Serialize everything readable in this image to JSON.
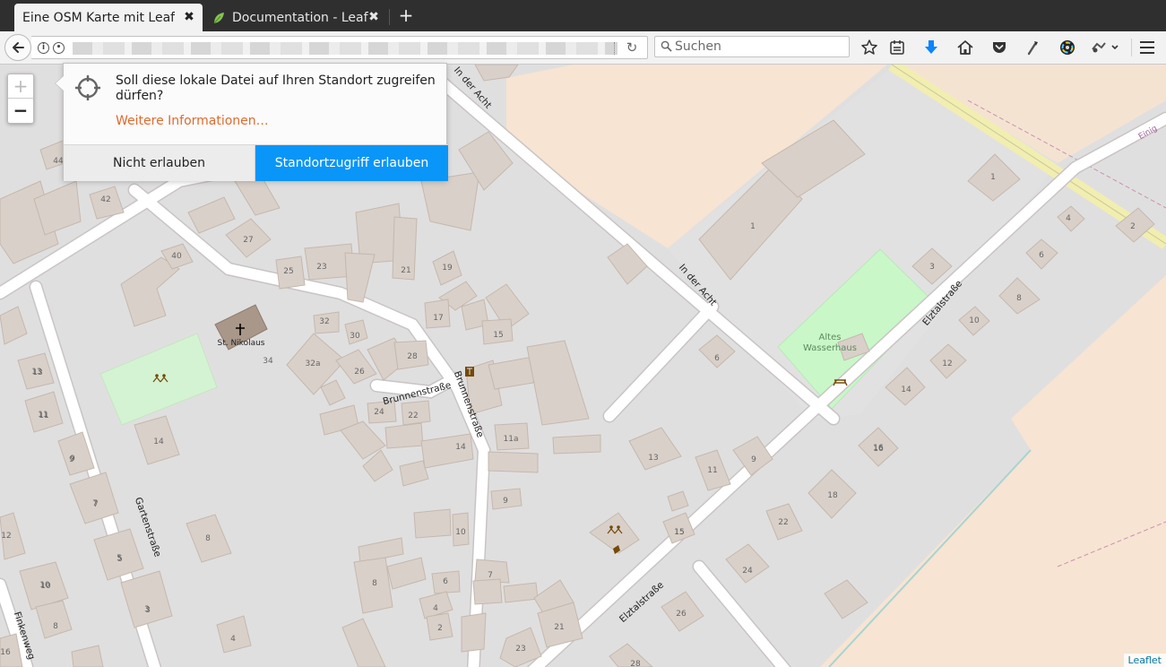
{
  "browser": {
    "tabs": [
      {
        "label": "Eine OSM Karte mit Leafle",
        "active": true
      },
      {
        "label": "Documentation - Leafl",
        "active": false
      }
    ],
    "new_tab_glyph": "+",
    "close_glyph": "✖",
    "search_placeholder": "Suchen",
    "toolbar_icons": [
      "back-arrow-icon",
      "info-icon",
      "permission-icon",
      "reload-icon",
      "search-icon",
      "bookmark-star-icon",
      "reading-list-icon",
      "download-icon",
      "home-icon",
      "pocket-icon",
      "extension-icon",
      "color-wheel-icon",
      "addon-icon",
      "hamburger-menu-icon"
    ],
    "accent_color": "#0996f8"
  },
  "permission_prompt": {
    "question": "Soll diese lokale Datei auf Ihren Standort zugreifen dürfen?",
    "more_info": "Weitere Informationen…",
    "deny_label": "Nicht erlauben",
    "allow_label": "Standortzugriff erlauben"
  },
  "map": {
    "zoom_in": "+",
    "zoom_out": "−",
    "attribution": "Leaflet",
    "street_labels": [
      "In der Acht",
      "In der Acht",
      "Elztalstraße",
      "Elztalstraße",
      "Brunnenstraße",
      "Brunnenstraße",
      "Gartenstraße",
      "Finkenweg",
      "Einig"
    ],
    "poi_labels": [
      "St. Nikolaus",
      "Altes",
      "Wasserhaus"
    ],
    "house_numbers": [
      "44",
      "42",
      "27",
      "40",
      "25",
      "23",
      "21",
      "19",
      "17",
      "15",
      "32",
      "30",
      "28",
      "34",
      "32a",
      "26",
      "24",
      "22",
      "14",
      "11a",
      "13",
      "11",
      "9",
      "7",
      "12",
      "5",
      "10",
      "8",
      "3",
      "16",
      "1",
      "1",
      "6",
      "3",
      "2",
      "4",
      "6",
      "8",
      "10",
      "12",
      "14",
      "16",
      "18",
      "22",
      "24",
      "26",
      "13",
      "11",
      "9",
      "15",
      "9",
      "10",
      "6",
      "4",
      "2",
      "8",
      "7",
      "21",
      "23",
      "28",
      "4",
      "14",
      "9",
      "15",
      "13",
      "11",
      "7",
      "5",
      "3",
      "8",
      "10",
      "16"
    ]
  }
}
